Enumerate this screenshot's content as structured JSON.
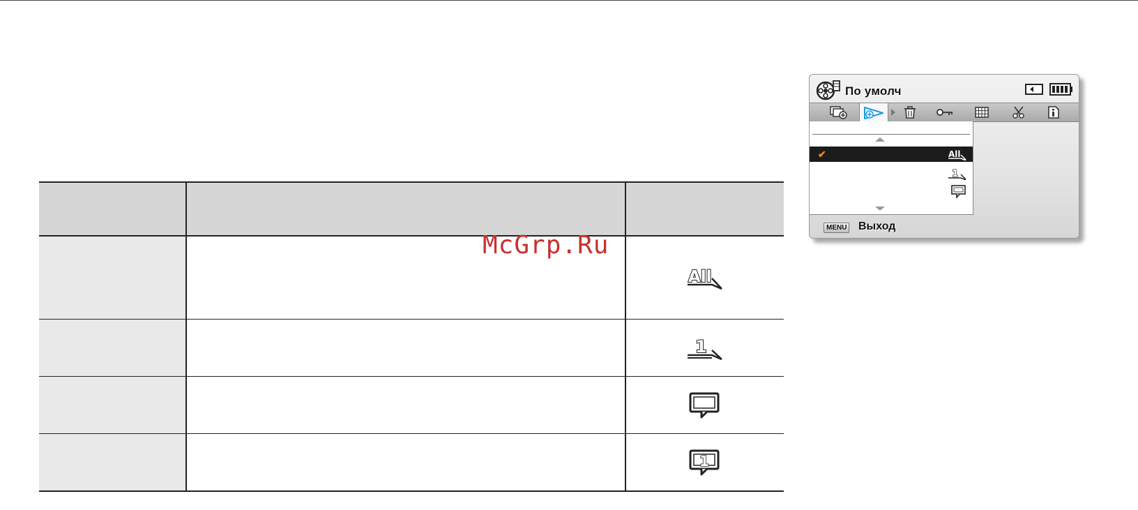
{
  "watermark": "McGrp.Ru",
  "table": {
    "rows": [
      {
        "icon": "play-all-icon",
        "icon_text": "All"
      },
      {
        "icon": "play-one-icon",
        "icon_text": "1"
      },
      {
        "icon": "repeat-all-icon"
      },
      {
        "icon": "repeat-one-icon",
        "icon_text": "1"
      }
    ]
  },
  "screen": {
    "title": "По умолч",
    "title_icon": "film-reel-icon",
    "status_icons": [
      "memory-card-icon",
      "battery-icon"
    ],
    "tabs": [
      {
        "icon": "multi-view-icon"
      },
      {
        "icon": "play-option-icon",
        "selected": true
      },
      {
        "icon": "delete-icon"
      },
      {
        "icon": "protect-key-icon"
      },
      {
        "icon": "thumbnail-grid-icon"
      },
      {
        "icon": "edit-scissors-icon"
      },
      {
        "icon": "file-info-icon"
      }
    ],
    "options": [
      {
        "icon": "play-all-icon",
        "icon_text": "All",
        "checked": true
      },
      {
        "icon": "play-one-icon",
        "icon_text": "1"
      },
      {
        "icon": "repeat-all-icon"
      }
    ],
    "check_mark": "✔",
    "menu_key": "MENU",
    "exit_label": "Выход"
  },
  "colors": {
    "accent": "#1d9be0",
    "check": "#f08c1e",
    "highlight": "#1c1c1c",
    "watermark": "#c9302c"
  }
}
